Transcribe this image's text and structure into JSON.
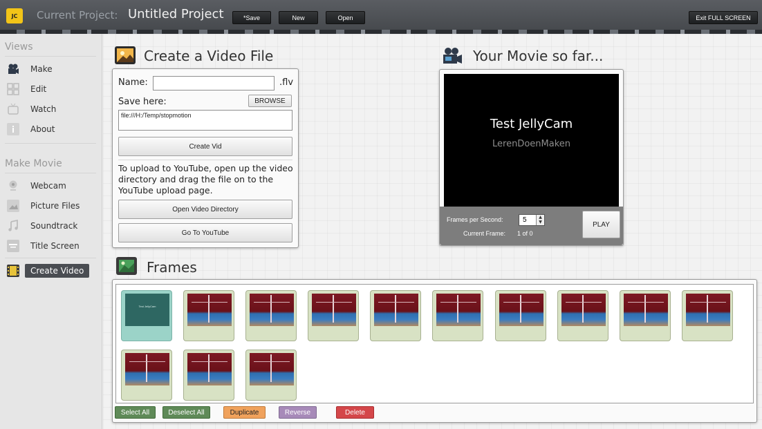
{
  "topbar": {
    "label": "Current Project:",
    "project_title": "Untitled Project",
    "logo_text": "JC",
    "buttons": {
      "save": "*Save",
      "new": "New",
      "open": "Open",
      "exit_fullscreen": "Exit FULL SCREEN"
    }
  },
  "sidebar": {
    "views_heading": "Views",
    "views": [
      "Make",
      "Edit",
      "Watch",
      "About"
    ],
    "make_heading": "Make Movie",
    "make_items": [
      "Webcam",
      "Picture Files",
      "Soundtrack",
      "Title Screen",
      "Create Video"
    ]
  },
  "create": {
    "title": "Create a Video File",
    "name_label": "Name:",
    "name_value": "",
    "ext": ".flv",
    "save_label": "Save here:",
    "browse": "BROWSE",
    "path": "file:///H:/Temp/stopmotion",
    "create_btn": "Create Vid",
    "upload_text": "To upload to YouTube, open up the video directory and drag the file on to the YouTube upload page.",
    "open_dir_btn": "Open Video Directory",
    "youtube_btn": "Go To YouTube"
  },
  "preview": {
    "title": "Your Movie so far...",
    "movie_title": "Test JellyCam",
    "movie_subtitle": "LerenDoenMaken",
    "fps_label": "Frames per Second:",
    "fps_value": "5",
    "current_frame_label": "Current Frame:",
    "current_frame_value": "1 of 0",
    "play": "PLAY"
  },
  "frames": {
    "title": "Frames",
    "title_frame_text": "Test JellyCam",
    "buttons": {
      "select_all": "Select All",
      "deselect_all": "Deselect All",
      "duplicate": "Duplicate",
      "reverse": "Reverse",
      "delete": "Delete"
    }
  },
  "colors": {
    "select_all": "#5f8a58",
    "deselect_all": "#5f8a58",
    "duplicate": "#f0a25c",
    "reverse": "#a78ab9",
    "delete": "#d4474a",
    "logo": "#f2c418"
  }
}
